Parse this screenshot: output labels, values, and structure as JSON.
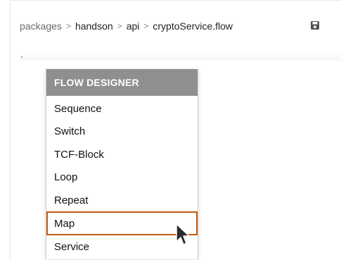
{
  "breadcrumb": {
    "items": [
      "packages",
      "handson",
      "api",
      "cryptoService.flow"
    ],
    "separator": ">"
  },
  "toolbar": {
    "save_icon": "save-icon"
  },
  "menu": {
    "title": "FLOW DESIGNER",
    "items": [
      "Sequence",
      "Switch",
      "TCF-Block",
      "Loop",
      "Repeat",
      "Map",
      "Service"
    ],
    "highlighted": "Map",
    "highlight_color": "#c55a11",
    "header_color": "#8f8f8f"
  }
}
